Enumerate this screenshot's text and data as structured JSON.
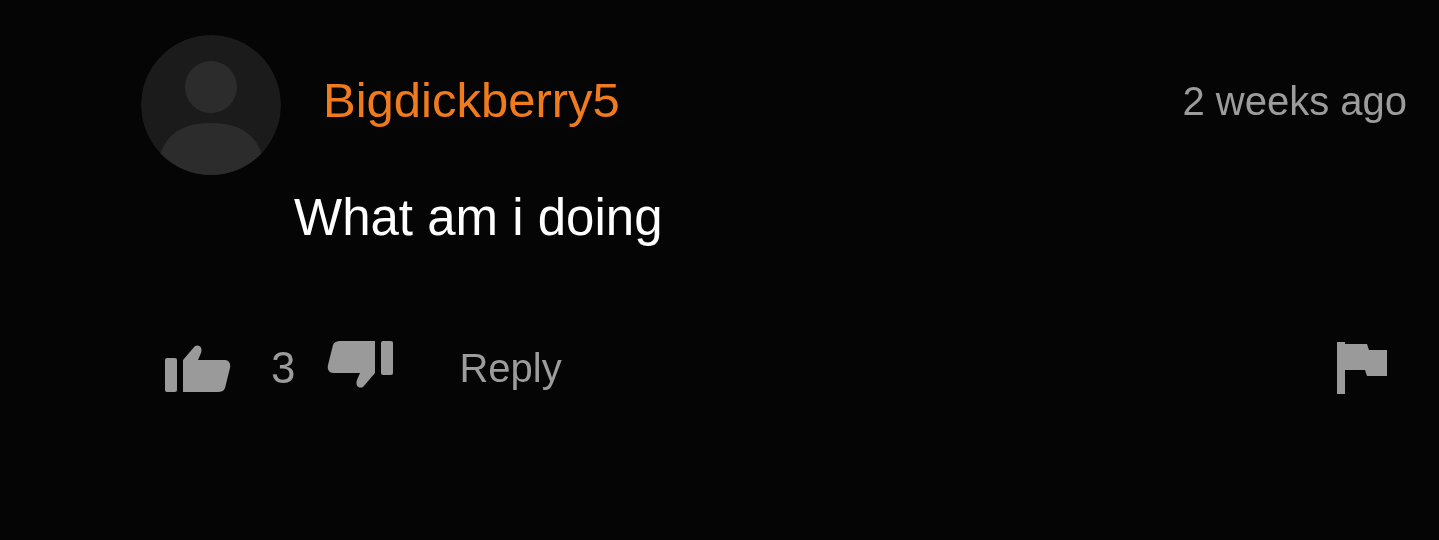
{
  "comment": {
    "author": "Bigdickberry5",
    "time": "2 weeks ago",
    "text": "What am i doing",
    "likes": "3",
    "reply": "Reply"
  }
}
